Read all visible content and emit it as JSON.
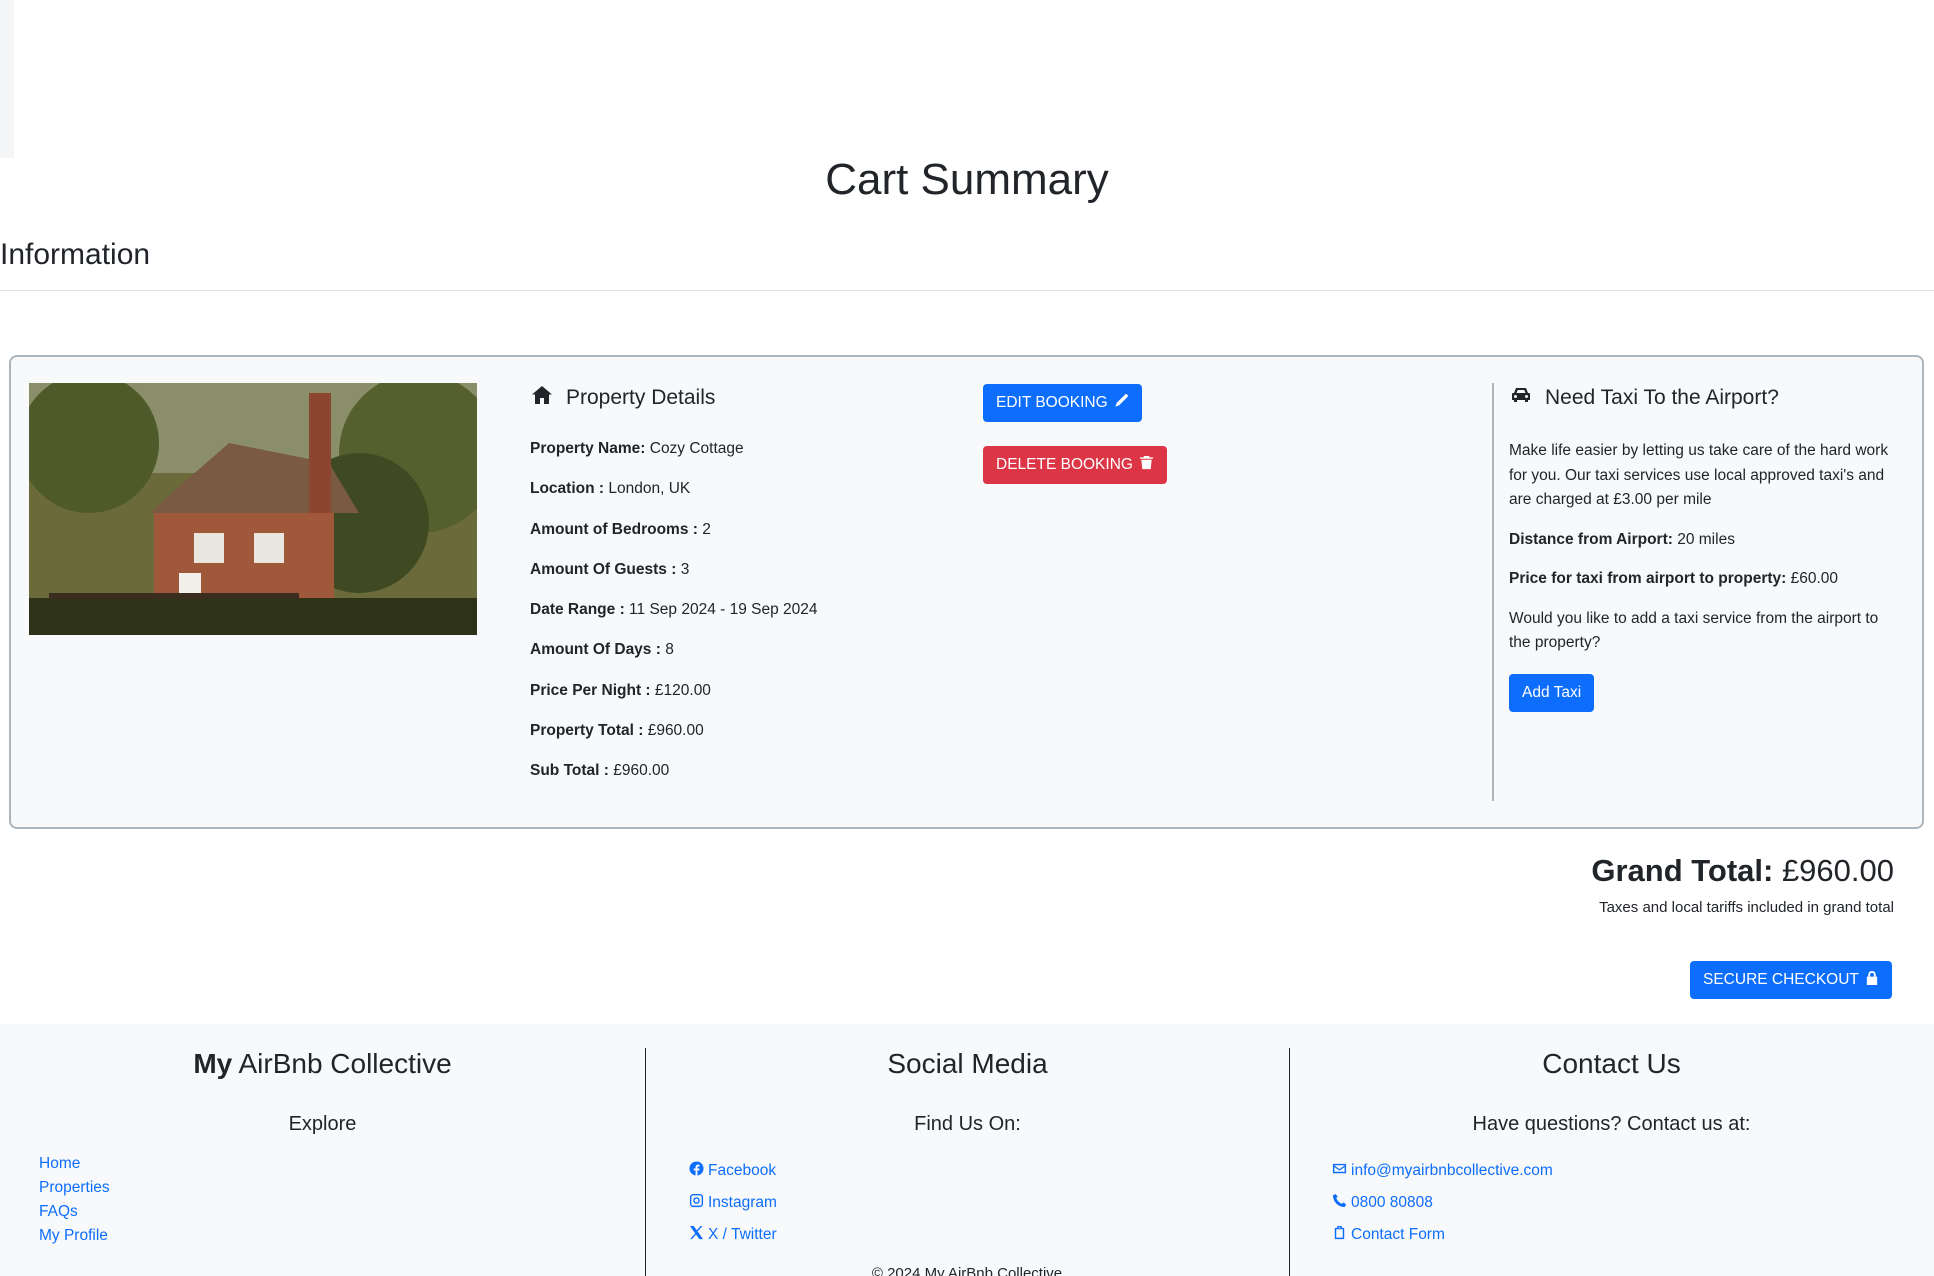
{
  "page": {
    "title": "Cart Summary",
    "section_title": "Information"
  },
  "property": {
    "heading": "Property Details",
    "rows": [
      {
        "label": "Property Name:",
        "value": " Cozy Cottage"
      },
      {
        "label": "Location :",
        "value": " London, UK"
      },
      {
        "label": "Amount of Bedrooms :",
        "value": " 2"
      },
      {
        "label": "Amount Of Guests :",
        "value": " 3"
      },
      {
        "label": "Date Range :",
        "value": " 11 Sep 2024 - 19 Sep 2024"
      },
      {
        "label": "Amount Of Days :",
        "value": " 8"
      },
      {
        "label": "Price Per Night :",
        "value": " £120.00"
      },
      {
        "label": "Property Total :",
        "value": " £960.00"
      },
      {
        "label": "Sub Total :",
        "value": " £960.00"
      }
    ]
  },
  "actions": {
    "edit_label": "EDIT BOOKING",
    "delete_label": "DELETE BOOKING"
  },
  "taxi": {
    "heading": "Need Taxi To the Airport?",
    "intro": "Make life easier by letting us take care of the hard work for you. Our taxi services use local approved taxi's and are charged at £3.00 per mile",
    "distance_label": "Distance from Airport:",
    "distance_value": " 20 miles",
    "price_label": "Price for taxi from airport to property:",
    "price_value": " £60.00",
    "question": "Would you like to add a taxi service from the airport to the property?",
    "button_label": "Add Taxi"
  },
  "totals": {
    "grand_label": "Grand Total:",
    "grand_value": " £960.00",
    "note": "Taxes and local tariffs included in grand total",
    "checkout_label": "SECURE CHECKOUT"
  },
  "footer": {
    "brand_bold": "My",
    "brand_rest": " AirBnb Collective",
    "explore_heading": "Explore",
    "explore_links": [
      "Home",
      "Properties",
      "FAQs",
      "My Profile"
    ],
    "social_heading": "Social Media",
    "social_sub": "Find Us On:",
    "social_links": [
      "Facebook",
      "Instagram",
      "X / Twitter"
    ],
    "contact_heading": "Contact Us",
    "contact_sub": "Have questions? Contact us at:",
    "contact_email": "info@myairbnbcollective.com",
    "contact_phone": "0800 80808",
    "contact_form": "Contact Form",
    "copyright": "© 2024 My AirBnb Collective"
  },
  "colors": {
    "primary": "#0d6efd",
    "danger": "#dc3545",
    "footer_bg": "#f8f9fa",
    "card_bg": "#f8f9fa"
  },
  "icons": [
    "house-icon",
    "pencil-icon",
    "trash-icon",
    "car-icon",
    "lock-icon",
    "facebook-icon",
    "instagram-icon",
    "x-twitter-icon",
    "envelope-icon",
    "phone-icon",
    "clipboard-icon"
  ]
}
